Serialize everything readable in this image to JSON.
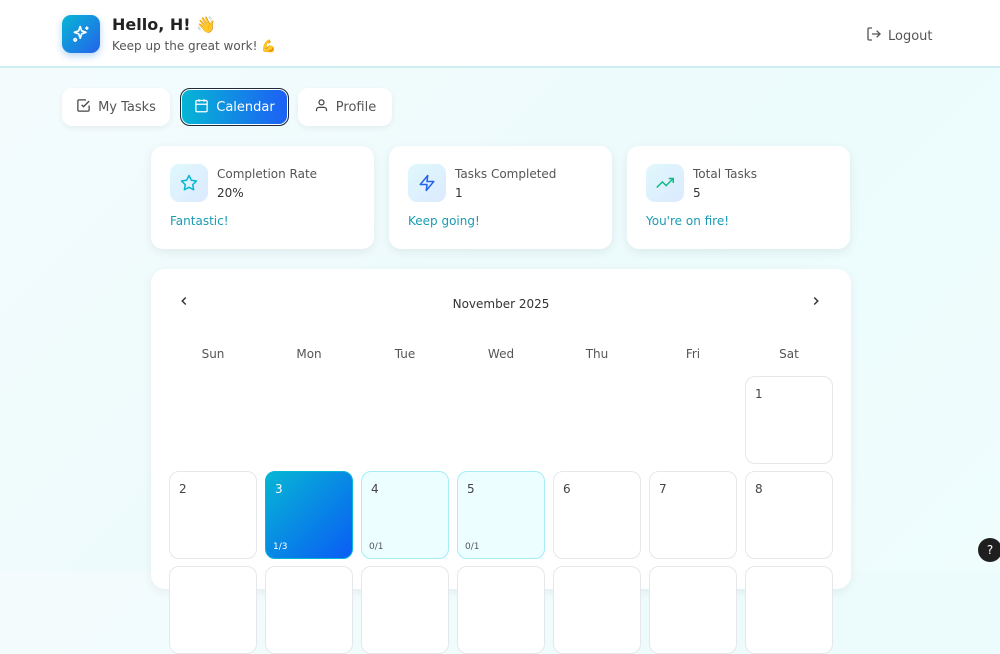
{
  "header": {
    "greeting": "Hello, H! 👋",
    "subtitle": "Keep up the great work! 💪",
    "logout": "Logout"
  },
  "tabs": [
    {
      "label": "My Tasks",
      "icon": "check-square-icon"
    },
    {
      "label": "Calendar",
      "icon": "calendar-icon",
      "active": true
    },
    {
      "label": "Profile",
      "icon": "user-icon"
    }
  ],
  "stats": [
    {
      "title": "Completion Rate",
      "value": "20%",
      "message": "Fantastic!",
      "icon": "star-icon"
    },
    {
      "title": "Tasks Completed",
      "value": "1",
      "message": "Keep going!",
      "icon": "zap-icon"
    },
    {
      "title": "Total Tasks",
      "value": "5",
      "message": "You're on fire!",
      "icon": "trending-up-icon"
    }
  ],
  "calendar": {
    "month": "November 2025",
    "weekdays": [
      "Sun",
      "Mon",
      "Tue",
      "Wed",
      "Thu",
      "Fri",
      "Sat"
    ],
    "days": [
      {
        "n": "1"
      },
      {
        "n": "2"
      },
      {
        "n": "3",
        "ratio": "1/3",
        "state": "today"
      },
      {
        "n": "4",
        "ratio": "0/1",
        "state": "task"
      },
      {
        "n": "5",
        "ratio": "0/1",
        "state": "task"
      },
      {
        "n": "6"
      },
      {
        "n": "7"
      },
      {
        "n": "8"
      }
    ]
  },
  "help": "?"
}
